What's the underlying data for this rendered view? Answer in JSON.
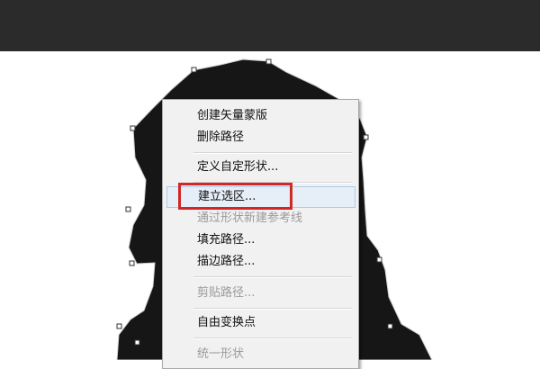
{
  "context_menu": {
    "items": [
      {
        "label": "创建矢量蒙版",
        "enabled": true
      },
      {
        "label": "删除路径",
        "enabled": true
      },
      {
        "label": "定义自定形状...",
        "enabled": true
      },
      {
        "label": "建立选区...",
        "enabled": true,
        "highlighted": true
      },
      {
        "label": "通过形状新建参考线",
        "enabled": false
      },
      {
        "label": "填充路径...",
        "enabled": true
      },
      {
        "label": "描边路径...",
        "enabled": true
      },
      {
        "label": "剪贴路径...",
        "enabled": false
      },
      {
        "label": "自由变换点",
        "enabled": true
      },
      {
        "label": "统一形状",
        "enabled": false
      }
    ]
  },
  "colors": {
    "topbar": "#2b2b2b",
    "shape_fill": "#161616",
    "menu_background": "#f1f1f1",
    "annotation_red": "#d22727"
  }
}
